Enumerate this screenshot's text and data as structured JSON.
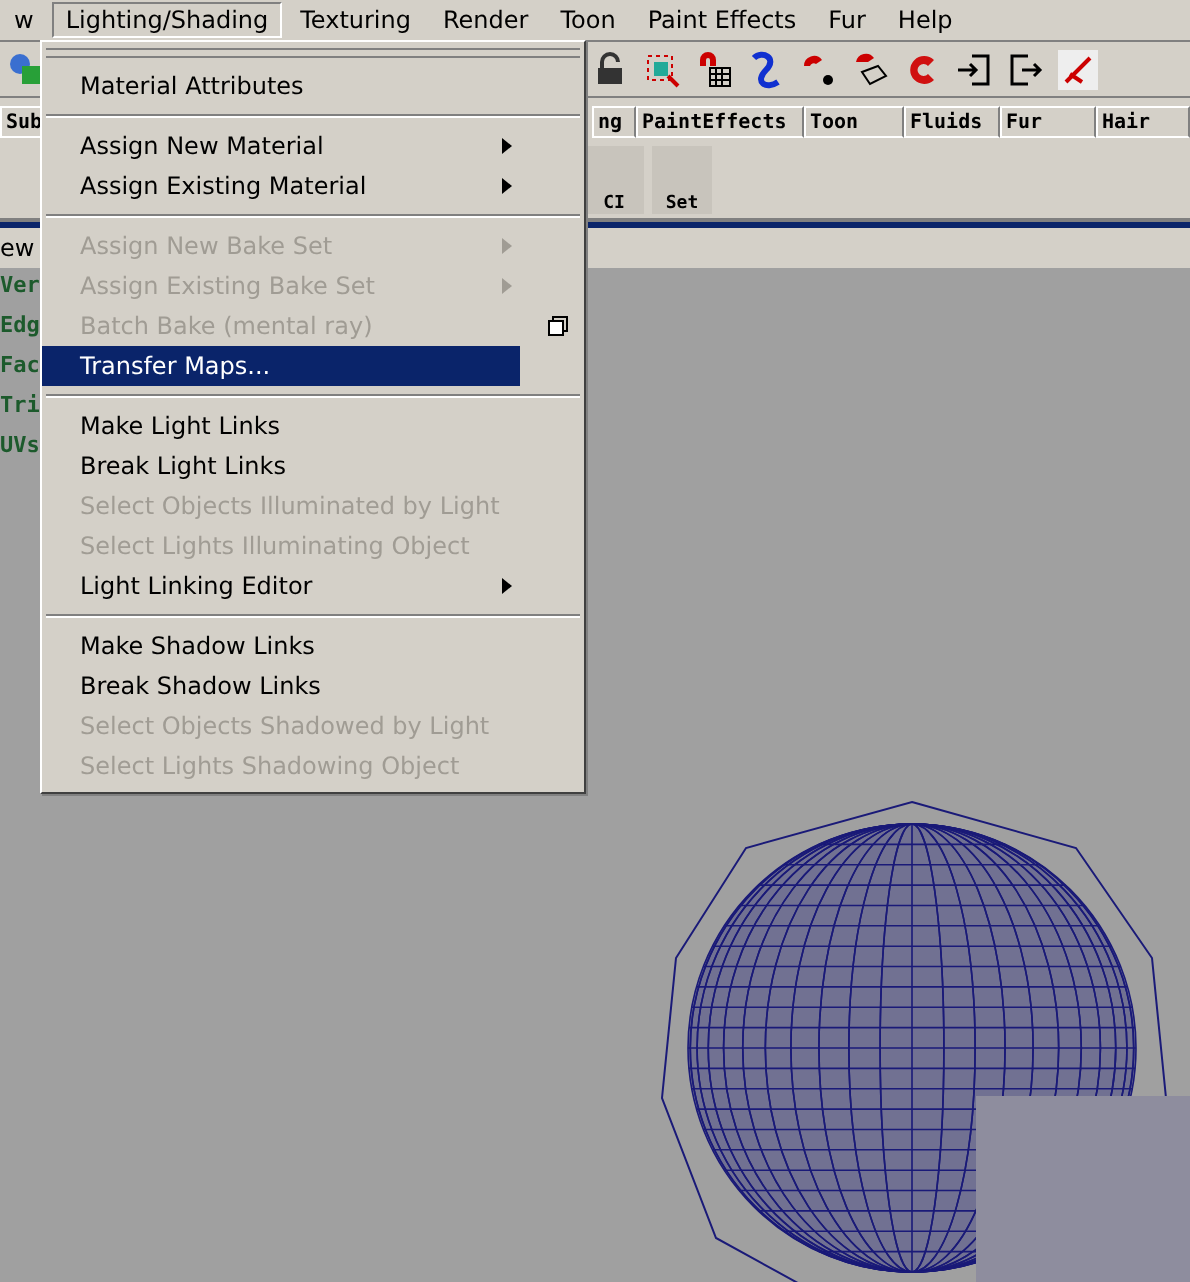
{
  "menubar": [
    {
      "label": "w",
      "selected": false
    },
    {
      "label": "Lighting/Shading",
      "selected": true
    },
    {
      "label": "Texturing",
      "selected": false
    },
    {
      "label": "Render",
      "selected": false
    },
    {
      "label": "Toon",
      "selected": false
    },
    {
      "label": "Paint Effects",
      "selected": false
    },
    {
      "label": "Fur",
      "selected": false
    },
    {
      "label": "Help",
      "selected": false
    }
  ],
  "shelf_tabs": [
    {
      "label": "Sub",
      "selected": false
    },
    {
      "label": "ng",
      "selected": false
    },
    {
      "label": "PaintEffects",
      "selected": false
    },
    {
      "label": "Toon",
      "selected": false
    },
    {
      "label": "Fluids",
      "selected": false
    },
    {
      "label": "Fur",
      "selected": false
    },
    {
      "label": "Hair",
      "selected": false
    }
  ],
  "shelf_buttons": [
    {
      "label": "CI"
    },
    {
      "label": "Set"
    }
  ],
  "panel_menu": "ew",
  "heads_up": [
    "Ver",
    "Edg",
    "Fac",
    "Tri",
    "UVs"
  ],
  "menu": [
    {
      "kind": "item",
      "label": "Material Attributes",
      "disabled": false,
      "submenu": false,
      "option_box": false,
      "selected": false
    },
    {
      "kind": "separator"
    },
    {
      "kind": "item",
      "label": "Assign New Material",
      "disabled": false,
      "submenu": true,
      "option_box": false,
      "selected": false
    },
    {
      "kind": "item",
      "label": "Assign Existing Material",
      "disabled": false,
      "submenu": true,
      "option_box": false,
      "selected": false
    },
    {
      "kind": "separator"
    },
    {
      "kind": "item",
      "label": "Assign New Bake Set",
      "disabled": true,
      "submenu": true,
      "option_box": false,
      "selected": false
    },
    {
      "kind": "item",
      "label": "Assign Existing Bake Set",
      "disabled": true,
      "submenu": true,
      "option_box": false,
      "selected": false
    },
    {
      "kind": "item",
      "label": "Batch Bake (mental ray)",
      "disabled": true,
      "submenu": false,
      "option_box": true,
      "selected": false
    },
    {
      "kind": "item",
      "label": "Transfer Maps...",
      "disabled": false,
      "submenu": false,
      "option_box": false,
      "selected": true
    },
    {
      "kind": "separator"
    },
    {
      "kind": "item",
      "label": "Make Light Links",
      "disabled": false,
      "submenu": false,
      "option_box": false,
      "selected": false
    },
    {
      "kind": "item",
      "label": "Break Light Links",
      "disabled": false,
      "submenu": false,
      "option_box": false,
      "selected": false
    },
    {
      "kind": "item",
      "label": "Select Objects Illuminated by Light",
      "disabled": true,
      "submenu": false,
      "option_box": false,
      "selected": false
    },
    {
      "kind": "item",
      "label": "Select Lights Illuminating Object",
      "disabled": true,
      "submenu": false,
      "option_box": false,
      "selected": false
    },
    {
      "kind": "item",
      "label": "Light Linking Editor",
      "disabled": false,
      "submenu": true,
      "option_box": false,
      "selected": false
    },
    {
      "kind": "separator"
    },
    {
      "kind": "item",
      "label": "Make Shadow Links",
      "disabled": false,
      "submenu": false,
      "option_box": false,
      "selected": false
    },
    {
      "kind": "item",
      "label": "Break Shadow Links",
      "disabled": false,
      "submenu": false,
      "option_box": false,
      "selected": false
    },
    {
      "kind": "item",
      "label": "Select Objects Shadowed by Light",
      "disabled": true,
      "submenu": false,
      "option_box": false,
      "selected": false
    },
    {
      "kind": "item",
      "label": "Select Lights Shadowing Object",
      "disabled": true,
      "submenu": false,
      "option_box": false,
      "selected": false
    }
  ]
}
